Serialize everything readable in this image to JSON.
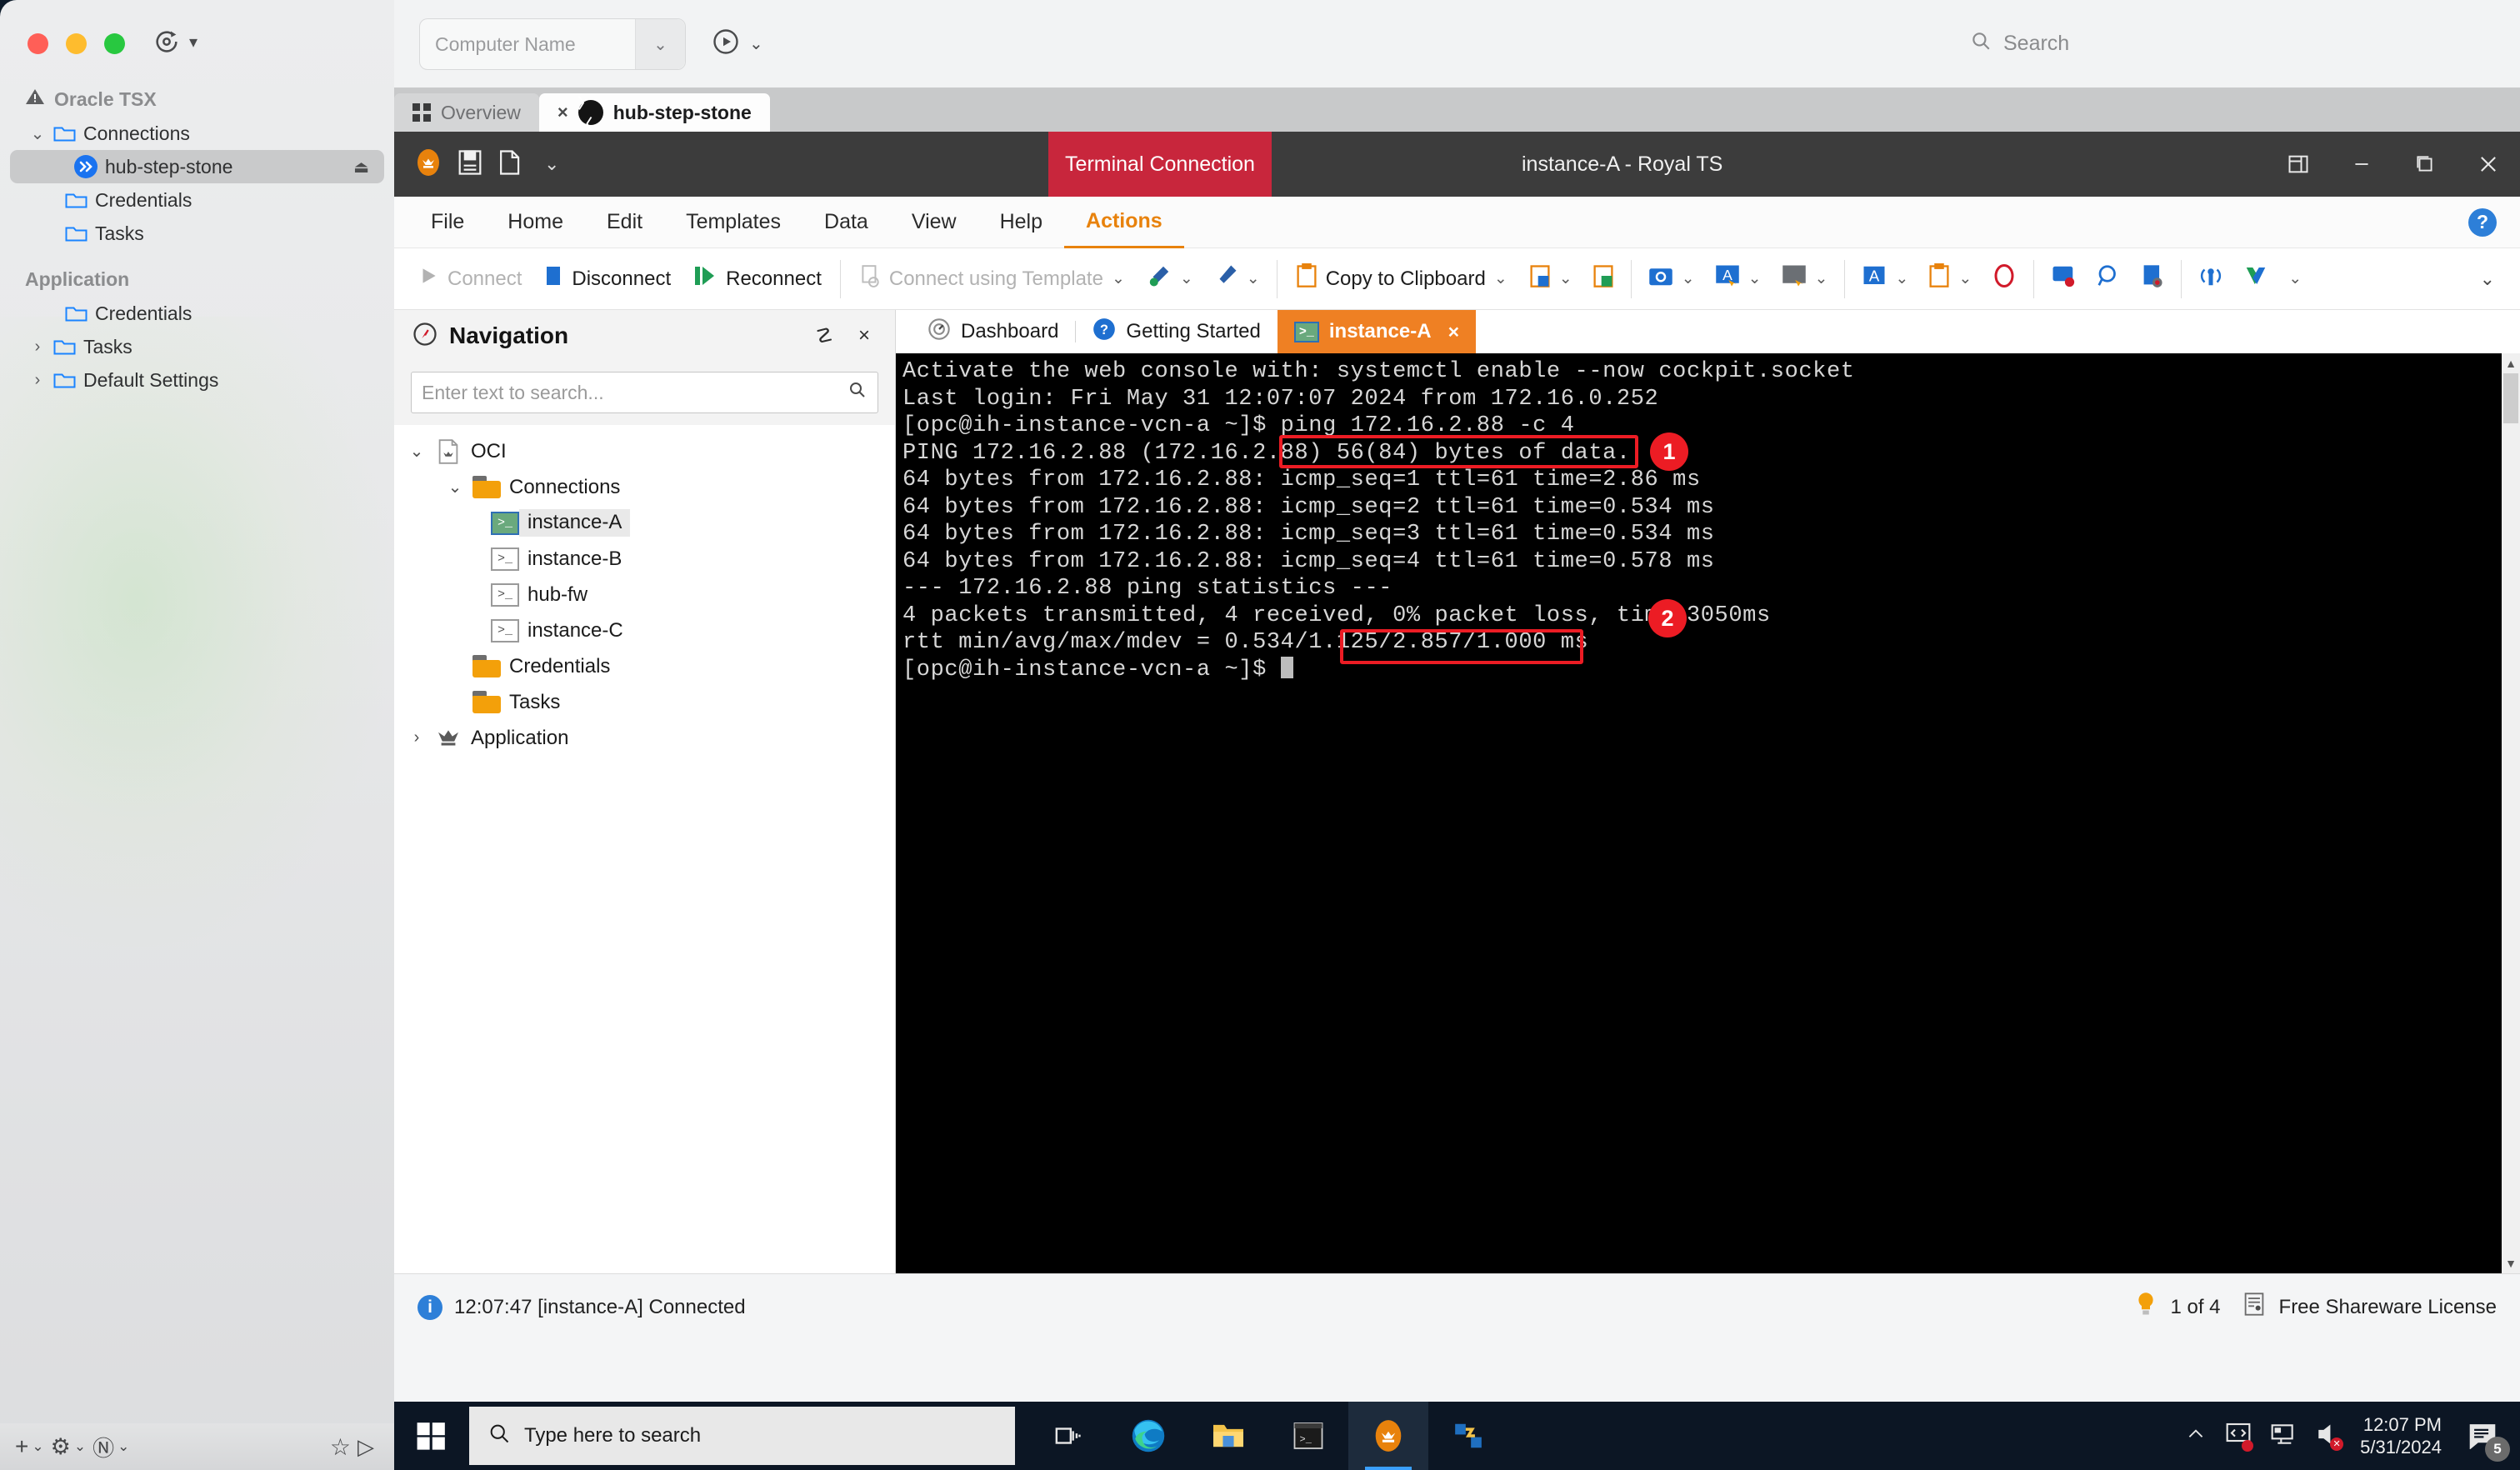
{
  "mac": {
    "sync_label": "sync-icon",
    "sections": [
      {
        "title": "Oracle TSX",
        "icon": "warning-triangle-icon",
        "items": [
          {
            "label": "Connections",
            "icon": "folder-icon",
            "twisty": "⌄",
            "indent": 1
          },
          {
            "label": "hub-step-stone",
            "icon": "remote-connection-icon",
            "indent": 2,
            "selected": true,
            "eject": "⏏"
          },
          {
            "label": "Credentials",
            "icon": "folder-icon",
            "indent": 2
          },
          {
            "label": "Tasks",
            "icon": "folder-icon",
            "indent": 2
          }
        ]
      },
      {
        "title": "Application",
        "icon": "",
        "items": [
          {
            "label": "Credentials",
            "icon": "folder-icon",
            "indent": 2
          },
          {
            "label": "Tasks",
            "icon": "folder-icon",
            "twisty": "›",
            "indent": 1
          },
          {
            "label": "Default Settings",
            "icon": "folder-icon",
            "twisty": "›",
            "indent": 1
          }
        ]
      }
    ],
    "bottom_bar": [
      {
        "name": "add-button",
        "glyph": "+",
        "caret": "⌄"
      },
      {
        "name": "settings-gear-button",
        "glyph": "⚙",
        "caret": "⌄"
      },
      {
        "name": "network-transfer-button",
        "glyph": "Ⓝ",
        "caret": "⌄"
      },
      {
        "name": "favorites-star-button",
        "glyph": "☆",
        "caret": ""
      },
      {
        "name": "play-button",
        "glyph": "▷",
        "caret": ""
      }
    ]
  },
  "rdp_top": {
    "computer_name_value": "Computer Name",
    "computer_name_caret": "⌄",
    "play_caret": "⌄",
    "search_placeholder": "Search"
  },
  "rdp_tabs": [
    {
      "label": "Overview",
      "icon": "grid-icon",
      "active": false
    },
    {
      "label": "hub-step-stone",
      "icon": "remote-connection-icon",
      "active": true,
      "close": "×"
    }
  ],
  "royalts": {
    "connection_badge": "Terminal Connection",
    "window_title": "instance-A - Royal TS",
    "quick_access": [
      "royalts-logo-icon",
      "save-icon",
      "new-document-icon",
      "customize-quick-access-icon"
    ],
    "window_buttons": [
      "restore-layout-icon",
      "minimize-icon",
      "maximize-icon",
      "close-icon"
    ],
    "menu": [
      {
        "label": "File",
        "active": false
      },
      {
        "label": "Home",
        "active": false
      },
      {
        "label": "Edit",
        "active": false
      },
      {
        "label": "Templates",
        "active": false
      },
      {
        "label": "Data",
        "active": false
      },
      {
        "label": "View",
        "active": false
      },
      {
        "label": "Help",
        "active": false
      },
      {
        "label": "Actions",
        "active": true
      }
    ],
    "help_glyph": "?",
    "ribbon": {
      "connect": "Connect",
      "disconnect": "Disconnect",
      "reconnect": "Reconnect",
      "connect_using_template": "Connect using Template",
      "copy_to_clipboard": "Copy to Clipboard",
      "caret": "⌄",
      "expand_caret": "⌄",
      "icon_buttons": [
        "key-tool-icon",
        "tool-icon",
        "copy-clipboard-text-icon",
        "copy-clipboard-secure-icon",
        "screenshot-icon",
        "type-text-icon",
        "type-credentials-icon",
        "font-icon",
        "clipboard-paste-icon",
        "no-entry-icon",
        "send-key-icon",
        "find-icon",
        "record-session-icon",
        "wifi-icon",
        "shuffle-icon"
      ]
    },
    "navigation": {
      "title": "Navigation",
      "compass_icon": "compass-icon",
      "pin_icon": "☡",
      "close_icon": "×",
      "search_placeholder": "Enter text to search...",
      "search_icon": "search-icon",
      "tree": [
        {
          "label": "OCI",
          "icon": "document-crown-icon",
          "twisty": "⌄",
          "level": 0
        },
        {
          "label": "Connections",
          "icon": "folder-icon",
          "twisty": "⌄",
          "level": 1
        },
        {
          "label": "instance-A",
          "icon": "terminal-icon",
          "level": 2,
          "selected": true,
          "connected": true
        },
        {
          "label": "instance-B",
          "icon": "terminal-icon",
          "level": 2
        },
        {
          "label": "hub-fw",
          "icon": "terminal-icon",
          "level": 2
        },
        {
          "label": "instance-C",
          "icon": "terminal-icon",
          "level": 2
        },
        {
          "label": "Credentials",
          "icon": "folder-icon",
          "level": 1
        },
        {
          "label": "Tasks",
          "icon": "folder-icon",
          "level": 1
        },
        {
          "label": "Application",
          "icon": "crown-icon",
          "twisty": "›",
          "level": 0
        }
      ]
    },
    "terminal_tabs": [
      {
        "label": "Dashboard",
        "icon": "dashboard-icon",
        "active": false
      },
      {
        "label": "Getting Started",
        "icon": "help-icon",
        "active": false
      },
      {
        "label": "instance-A",
        "icon": "terminal-icon",
        "active": true,
        "close": "×"
      }
    ],
    "terminal_lines": [
      "Activate the web console with: systemctl enable --now cockpit.socket",
      "",
      "Last login: Fri May 31 12:07:07 2024 from 172.16.0.252",
      "[opc@ih-instance-vcn-a ~]$ ping 172.16.2.88 -c 4",
      "PING 172.16.2.88 (172.16.2.88) 56(84) bytes of data.",
      "64 bytes from 172.16.2.88: icmp_seq=1 ttl=61 time=2.86 ms",
      "64 bytes from 172.16.2.88: icmp_seq=2 ttl=61 time=0.534 ms",
      "64 bytes from 172.16.2.88: icmp_seq=3 ttl=61 time=0.534 ms",
      "64 bytes from 172.16.2.88: icmp_seq=4 ttl=61 time=0.578 ms",
      "",
      "--- 172.16.2.88 ping statistics ---",
      "4 packets transmitted, 4 received, 0% packet loss, time 3050ms",
      "rtt min/avg/max/mdev = 0.534/1.125/2.857/1.000 ms"
    ],
    "terminal_prompt": "[opc@ih-instance-vcn-a ~]$ ",
    "annotations": [
      {
        "number": "1",
        "target": "ping 172.16.2.88 -c 4"
      },
      {
        "number": "2",
        "target": "0% packet loss,"
      }
    ],
    "status_bar": {
      "message": "12:07:47 [instance-A] Connected",
      "info_glyph": "i",
      "tip_icon": "lightbulb-icon",
      "tip_counter": "1 of 4",
      "license_icon": "license-icon",
      "license_text": "Free Shareware License"
    }
  },
  "taskbar": {
    "start_icon": "windows-start-icon",
    "search_placeholder": "Type here to search",
    "search_icon": "search-icon",
    "pinned": [
      {
        "name": "task-view-icon",
        "active": false
      },
      {
        "name": "microsoft-edge-icon",
        "active": false
      },
      {
        "name": "file-explorer-icon",
        "active": false
      },
      {
        "name": "terminal-icon",
        "active": false
      },
      {
        "name": "royalts-icon",
        "active": true
      },
      {
        "name": "remote-tool-icon",
        "active": false
      }
    ],
    "tray": [
      "show-hidden-icons-caret",
      "screen-share-icon",
      "network-icon",
      "volume-muted-icon"
    ],
    "clock_time": "12:07 PM",
    "clock_date": "5/31/2024",
    "notification_count": "5"
  },
  "colors": {
    "accent_orange": "#ef8023",
    "brand_red": "#c8263c",
    "annotation_red": "#ec1c24",
    "folder_orange": "#f3a00a",
    "link_blue": "#2d7fd8"
  }
}
